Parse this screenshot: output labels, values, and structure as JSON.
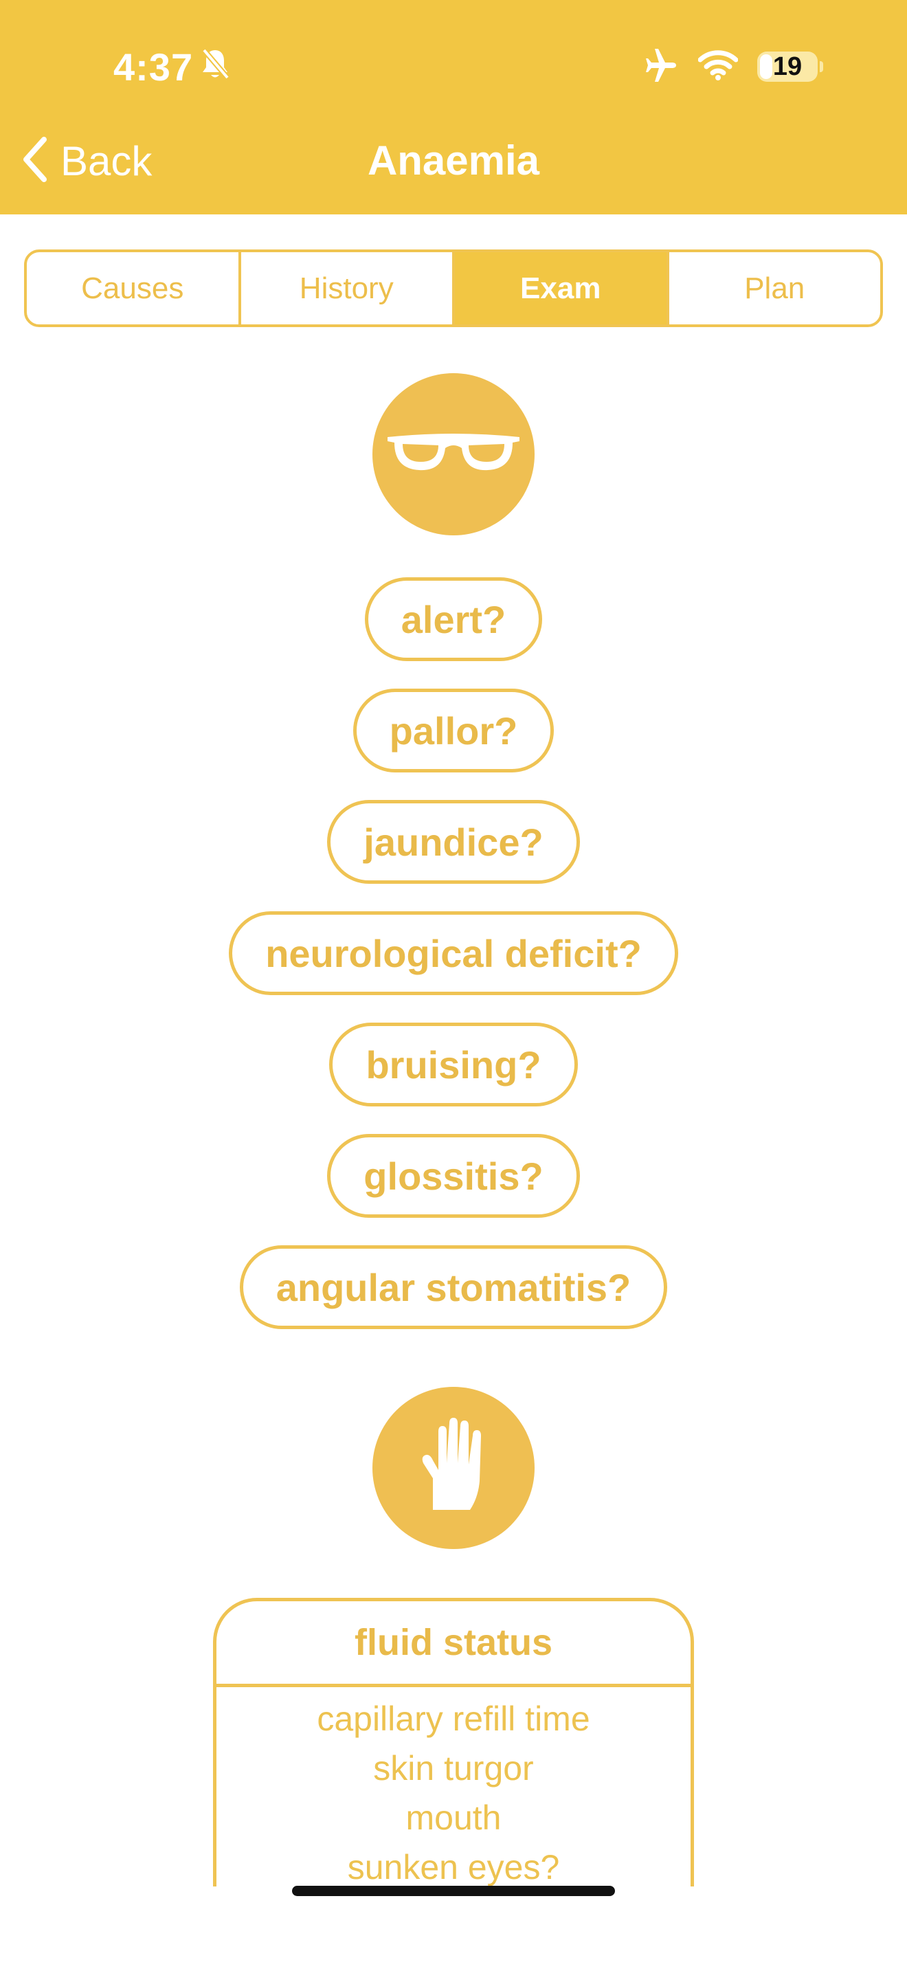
{
  "status_bar": {
    "time": "4:37",
    "battery": "19",
    "icons": [
      "bell-slash-icon",
      "airplane-icon",
      "wifi-icon",
      "battery-icon"
    ]
  },
  "nav": {
    "back_label": "Back",
    "title": "Anaemia"
  },
  "tabs": [
    {
      "label": "Causes",
      "active": false
    },
    {
      "label": "History",
      "active": false
    },
    {
      "label": "Exam",
      "active": true
    },
    {
      "label": "Plan",
      "active": false
    }
  ],
  "sections": {
    "general": {
      "icon": "glasses-icon",
      "items": [
        "alert?",
        "pallor?",
        "jaundice?",
        "neurological deficit?",
        "bruising?",
        "glossitis?",
        "angular stomatitis?"
      ]
    },
    "hands": {
      "icon": "hand-icon",
      "card_title": "fluid status",
      "card_items": [
        "capillary refill time",
        "skin turgor",
        "mouth",
        "sunken eyes?"
      ]
    }
  },
  "colors": {
    "accent": "#F2C643",
    "circle": "#EFBF52",
    "pill_text": "#E9BA4A",
    "pill_border": "#EFC353"
  }
}
